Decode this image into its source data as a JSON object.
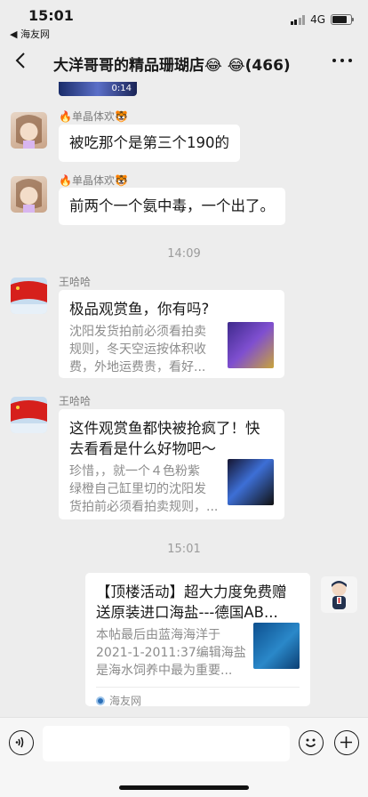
{
  "status": {
    "time": "15:01",
    "back_app": "◀ 海友网",
    "network": "4G"
  },
  "header": {
    "title": "大洋哥哥的精品珊瑚店😂 😂(466)"
  },
  "video": {
    "duration": "0:14"
  },
  "messages": [
    {
      "sender": "🔥单晶体欢🐯",
      "text": "被吃那个是第三个190的"
    },
    {
      "sender": "🔥单晶体欢🐯",
      "text": "前两个一个氨中毒，一个出了。"
    }
  ],
  "time_1": "14:09",
  "cards": [
    {
      "sender": "王哈哈",
      "title_lines": [
        "极品观赏鱼，你有吗?"
      ],
      "desc_lines": [
        "沈阳发货拍前必须看拍卖",
        "规则，冬天空运按体积收",
        "费，外地运费贵，看好..."
      ]
    },
    {
      "sender": "王哈哈",
      "title_lines": [
        "这件观赏鱼都快被抢疯了！快",
        "去看看是什么好物吧～"
      ],
      "desc_lines": [
        "珍惜，，就一个４色粉紫",
        "绿橙自己缸里切的沈阳发",
        "货拍前必须看拍卖规则，..."
      ]
    }
  ],
  "time_2": "15:01",
  "link_card": {
    "title_lines": [
      "【顶楼活动】超大力度免费赠",
      "送原装进口海盐---德国AB..."
    ],
    "desc_lines": [
      "本帖最后由蓝海海洋于",
      "2021-1-2011:37编辑海盐",
      "是海水饲养中最为重要..."
    ],
    "source": "海友网"
  },
  "colors": {
    "background": "#ededed",
    "bubble": "#ffffff",
    "meta_text": "#7f7f7f"
  }
}
